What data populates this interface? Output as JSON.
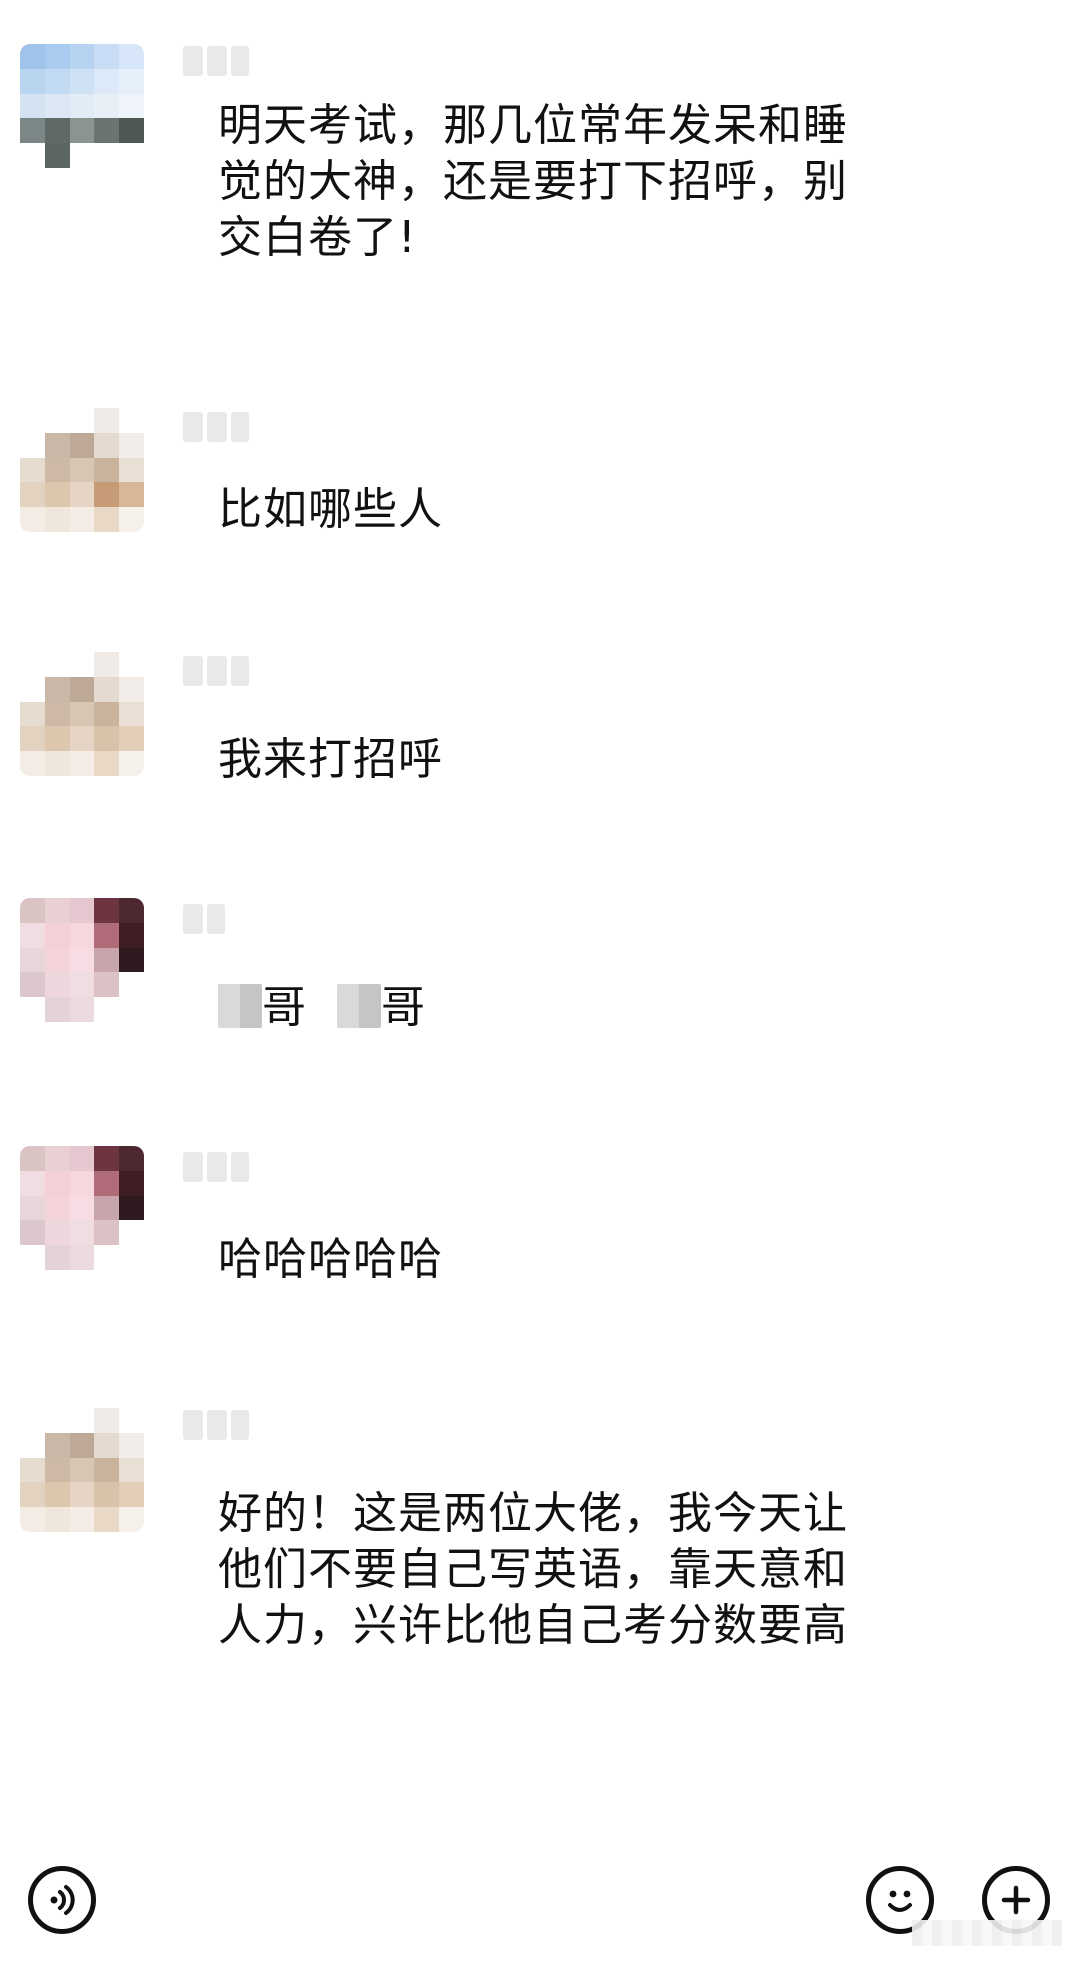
{
  "messages": [
    {
      "id": 1,
      "text": "明天考试，那几位常年发呆和睡觉的大神，还是要打下招呼，别交白卷了!"
    },
    {
      "id": 2,
      "text": "比如哪些人"
    },
    {
      "id": 3,
      "text": "我来打招呼"
    },
    {
      "id": 4,
      "text_part1": "哥",
      "text_part2": "哥"
    },
    {
      "id": 5,
      "text": "哈哈哈哈哈"
    },
    {
      "id": 6,
      "text": "好的！这是两位大佬，我今天让他们不要自己写英语，靠天意和人力，兴许比他自己考分数要高"
    }
  ],
  "toolbar": {
    "voice_icon": "voice-icon",
    "emoji_icon": "smiley-icon",
    "plus_icon": "plus-icon"
  },
  "colors": {
    "background": "#ffffff",
    "text": "#111111"
  }
}
